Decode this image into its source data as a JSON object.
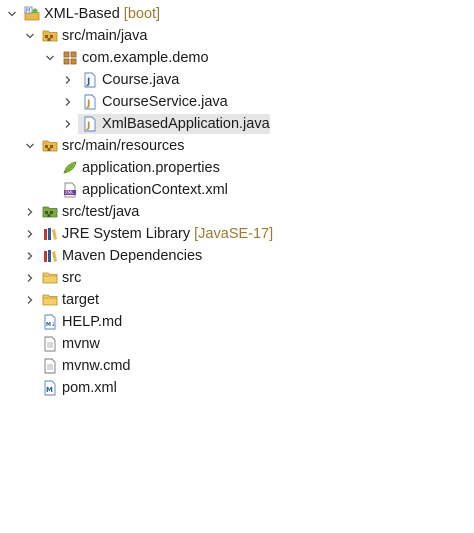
{
  "tree": {
    "project": {
      "label": "XML-Based",
      "decoration": "[boot]"
    },
    "src_main_java": {
      "label": "src/main/java"
    },
    "package": {
      "label": "com.example.demo"
    },
    "files_java": [
      {
        "label": "Course.java"
      },
      {
        "label": "CourseService.java"
      },
      {
        "label": "XmlBasedApplication.java"
      }
    ],
    "src_main_resources": {
      "label": "src/main/resources"
    },
    "resources": [
      {
        "label": "application.properties"
      },
      {
        "label": "applicationContext.xml"
      }
    ],
    "src_test_java": {
      "label": "src/test/java"
    },
    "jre": {
      "label": "JRE System Library",
      "decoration": "[JavaSE-17]"
    },
    "maven": {
      "label": "Maven Dependencies"
    },
    "src": {
      "label": "src"
    },
    "target": {
      "label": "target"
    },
    "root_files": [
      {
        "label": "HELP.md"
      },
      {
        "label": "mvnw"
      },
      {
        "label": "mvnw.cmd"
      },
      {
        "label": "pom.xml"
      }
    ]
  },
  "colors": {
    "selection": "#e5e5e5",
    "decoration": "#9a7b2f",
    "folder": "#e8b84a",
    "java_blue": "#2c5aa0"
  },
  "icons": {
    "expanded": "chevron-down-icon",
    "collapsed": "chevron-right-icon",
    "project": "spring-project-icon",
    "source_folder": "source-folder-icon",
    "package": "package-icon",
    "java_file": "java-file-icon",
    "properties": "properties-file-icon",
    "xml": "xml-file-icon",
    "library": "library-icon",
    "folder": "folder-icon",
    "md": "markdown-file-icon",
    "text": "text-file-icon",
    "maven_pom": "maven-pom-icon"
  }
}
